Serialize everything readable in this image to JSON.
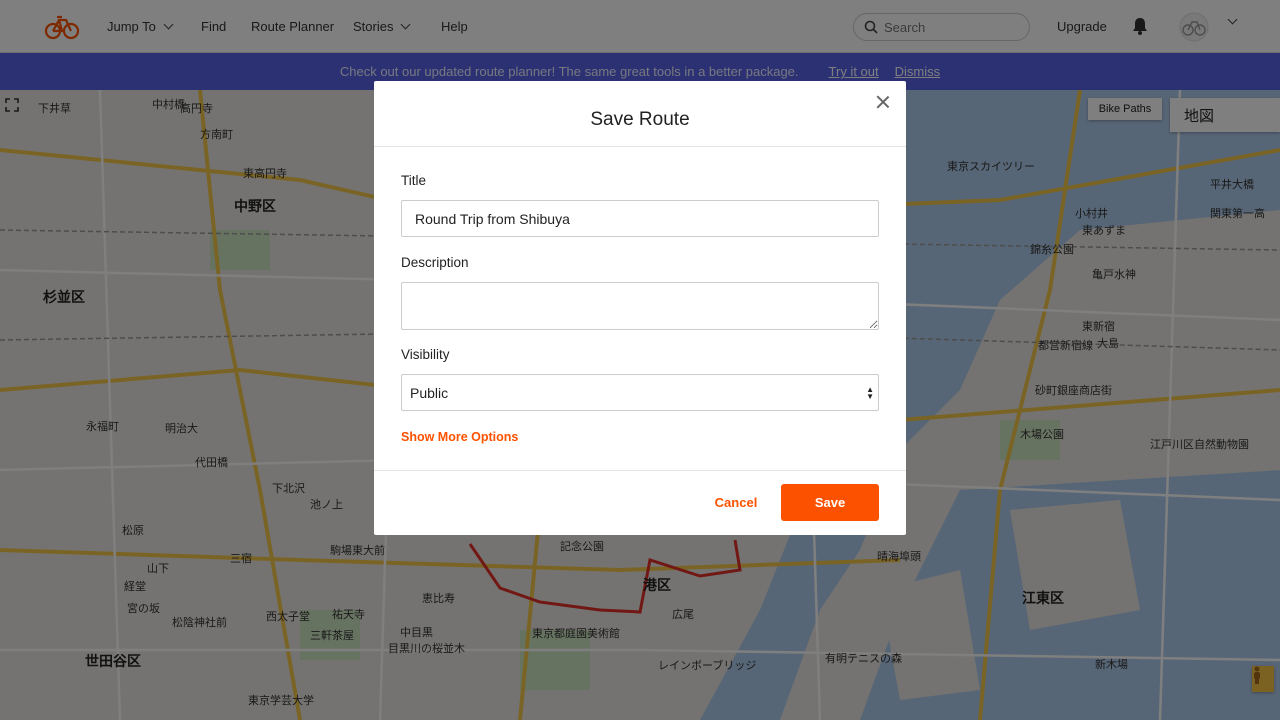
{
  "nav": {
    "logo_icon": "cycling-icon",
    "items": [
      {
        "label": "Jump To",
        "has_dropdown": true
      },
      {
        "label": "Find",
        "has_dropdown": false
      },
      {
        "label": "Route Planner",
        "has_dropdown": false
      },
      {
        "label": "Stories",
        "has_dropdown": true
      },
      {
        "label": "Help",
        "has_dropdown": false
      }
    ],
    "search_placeholder": "Search",
    "upgrade_label": "Upgrade",
    "accent_color": "#fc5200"
  },
  "banner": {
    "message": "Check out our updated route planner! The same great tools in a better package.",
    "try_label": "Try it out",
    "dismiss_label": "Dismiss",
    "color": "#5863e8"
  },
  "map": {
    "layer_button": "Bike Paths",
    "map_type": "地図",
    "labels": [
      "下井草",
      "中村橋",
      "中野区",
      "杉並区",
      "世田谷区",
      "港区",
      "江東区",
      "東京スカイツリー",
      "都営新宿線",
      "大島",
      "木場公園",
      "江戸川区自然動物園",
      "東新宿",
      "砂町銀座商店街",
      "新木場",
      "レインボーブリッジ",
      "晴海埠頭",
      "有明テニスの森",
      "恵比寿",
      "目黒川の桜並木",
      "東京都庭園美術館",
      "三軒茶屋",
      "高円寺",
      "方南町",
      "東高円寺",
      "永福町",
      "明治大",
      "代田橋",
      "池ノ上",
      "下北沢",
      "駒場東大前",
      "三宿",
      "西太子堂",
      "松原",
      "経堂",
      "宮の坂",
      "山下",
      "松陰神社前",
      "東京学芸大学",
      "祐天寺",
      "中目黒",
      "広尾",
      "記念公園",
      "亀戸水神",
      "錦糸公園",
      "平井大橋",
      "関東第一高",
      "小村井",
      "東あずま"
    ]
  },
  "modal": {
    "title": "Save Route",
    "title_label": "Title",
    "title_value": "Round Trip from Shibuya",
    "description_label": "Description",
    "description_value": "",
    "visibility_label": "Visibility",
    "visibility_value": "Public",
    "more_options_label": "Show More Options",
    "cancel_label": "Cancel",
    "save_label": "Save"
  }
}
